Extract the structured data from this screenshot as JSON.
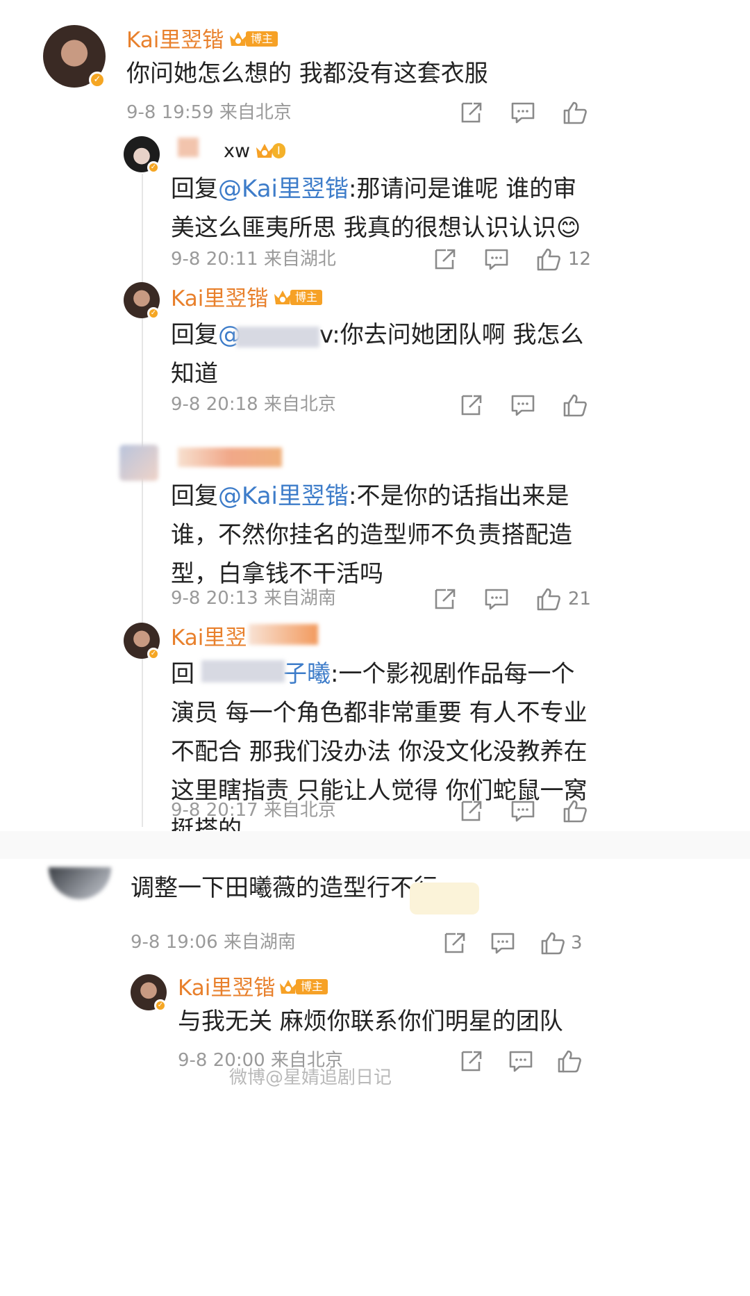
{
  "colors": {
    "accent_name": "#e8802c",
    "mention": "#3d7cc9",
    "meta": "#9a9a9a",
    "badge": "#f6a126"
  },
  "comments": [
    {
      "user": "Kai里翌锴",
      "badge": "博主",
      "text": "你问她怎么想的 我都没有这套衣服",
      "meta": "9-8 19:59 来自北京",
      "likes": "",
      "replies": [
        {
          "user": "xw",
          "badge": "Ⅰ",
          "reply_prefix": "回复",
          "mention": "@Kai里翌锴",
          "text": ":那请问是谁呢 谁的审美这么匪夷所思 我真的很想认识认识",
          "emoji": "😊",
          "meta": "9-8 20:11 来自湖北",
          "likes": "12"
        },
        {
          "user": "Kai里翌锴",
          "badge": "博主",
          "reply_prefix": "回复",
          "mention": "@",
          "mention_tail": "v",
          "text": ":你去问她团队啊 我怎么知道",
          "meta": "9-8 20:18 来自北京",
          "likes": ""
        },
        {
          "user": "",
          "badge": "",
          "reply_prefix": "回复",
          "mention": "@Kai里翌锴",
          "text": ":不是你的话指出来是谁，不然你挂名的造型师不负责搭配造型，白拿钱不干活吗",
          "meta": "9-8 20:13 来自湖南",
          "likes": "21"
        },
        {
          "user": "Kai里翌",
          "badge": "",
          "reply_prefix": "回",
          "mention": "子曦",
          "text": ":一个影视剧作品每一个演员 每一个角色都非常重要 有人不专业不配合 那我们没办法 你没文化没教养在这里瞎指责 只能让人觉得 你们蛇鼠一窝 挺搭的",
          "meta": "9-8 20:17 来自北京",
          "likes": ""
        }
      ]
    },
    {
      "user": "",
      "badge": "",
      "text": "调整一下田曦薇的造型行不行。",
      "meta": "9-8 19:06 来自湖南",
      "likes": "3",
      "replies": [
        {
          "user": "Kai里翌锴",
          "badge": "博主",
          "text": "与我无关 麻烦你联系你们明星的团队",
          "meta": "9-8 20:00 来自北京",
          "likes": ""
        }
      ]
    }
  ],
  "watermark": "微博@星婧追剧日记",
  "icons": {
    "share": "share-icon",
    "comment": "comment-icon",
    "like": "like-icon",
    "verified": "verified-icon",
    "crown": "crown-icon"
  }
}
